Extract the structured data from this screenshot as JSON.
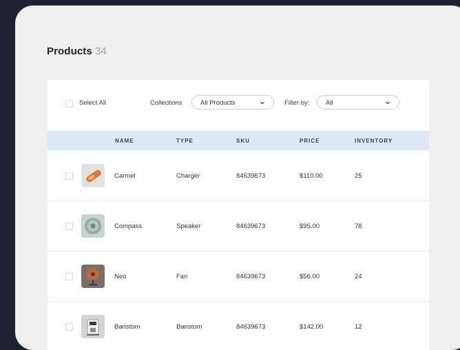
{
  "header": {
    "title": "Products",
    "count": "34"
  },
  "toolbar": {
    "select_all_label": "Select All",
    "collections_label": "Collections",
    "collections_value": "All Products",
    "filter_label": "Filter by:",
    "filter_value": "All"
  },
  "table": {
    "columns": [
      "NAME",
      "TYPE",
      "SKU",
      "PRICE",
      "INVENTORY"
    ],
    "rows": [
      {
        "name": "Carmel",
        "type": "Charger",
        "sku": "84639673",
        "price": "$110.00",
        "inventory": "25",
        "thumb": "charger-product-thumb"
      },
      {
        "name": "Compass",
        "type": "Speaker",
        "sku": "84639673",
        "price": "$95.00",
        "inventory": "78",
        "thumb": "speaker-product-thumb"
      },
      {
        "name": "Neo",
        "type": "Fan",
        "sku": "84639673",
        "price": "$56.00",
        "inventory": "24",
        "thumb": "fan-product-thumb"
      },
      {
        "name": "Baristom",
        "type": "Baristom",
        "sku": "84639673",
        "price": "$142.00",
        "inventory": "12",
        "thumb": "coffee-machine-product-thumb"
      }
    ]
  },
  "colors": {
    "background": "#1c2330",
    "panel": "#efefef",
    "header_row": "#dde8f6"
  }
}
